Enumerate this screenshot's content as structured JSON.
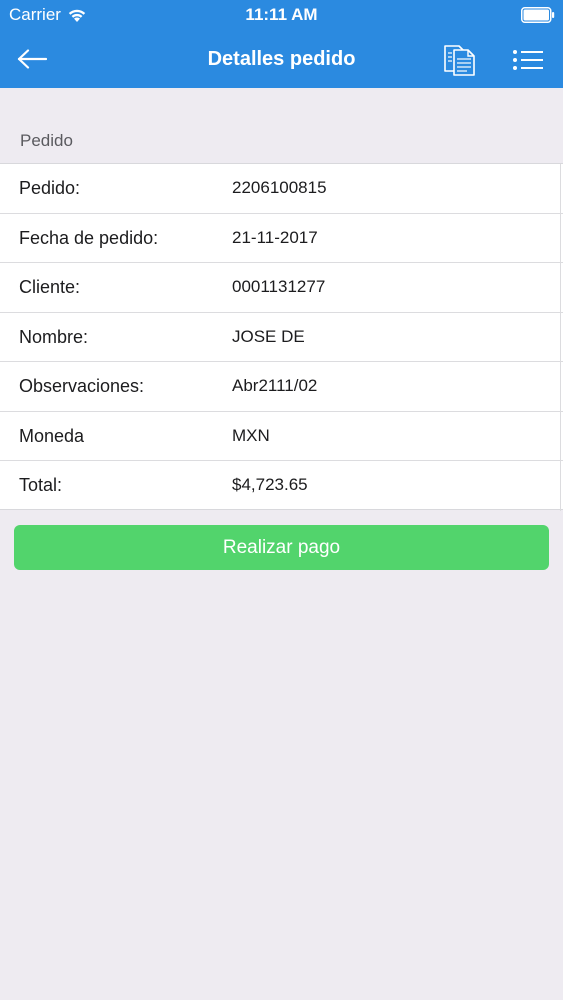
{
  "status_bar": {
    "carrier": "Carrier",
    "time": "11:11 AM",
    "icons": [
      "wifi-icon",
      "battery-icon"
    ]
  },
  "nav": {
    "title": "Detalles pedido",
    "back_icon": "arrow-left-icon",
    "doc_icon": "documents-icon",
    "menu_icon": "list-icon",
    "bar_color": "#2b8ae0"
  },
  "section": {
    "header": "Pedido"
  },
  "details": [
    {
      "label": "Pedido:",
      "value": "2206100815"
    },
    {
      "label": "Fecha de pedido:",
      "value": "21-11-2017"
    },
    {
      "label": "Cliente:",
      "value": "0001131277"
    },
    {
      "label": "Nombre:",
      "value": "JOSE DE"
    },
    {
      "label": "Observaciones:",
      "value": "Abr2111/02"
    },
    {
      "label": "Moneda",
      "value": "MXN"
    },
    {
      "label": "Total:",
      "value": "$4,723.65"
    }
  ],
  "actions": {
    "pay_label": "Realizar pago",
    "pay_color": "#52d46c"
  }
}
